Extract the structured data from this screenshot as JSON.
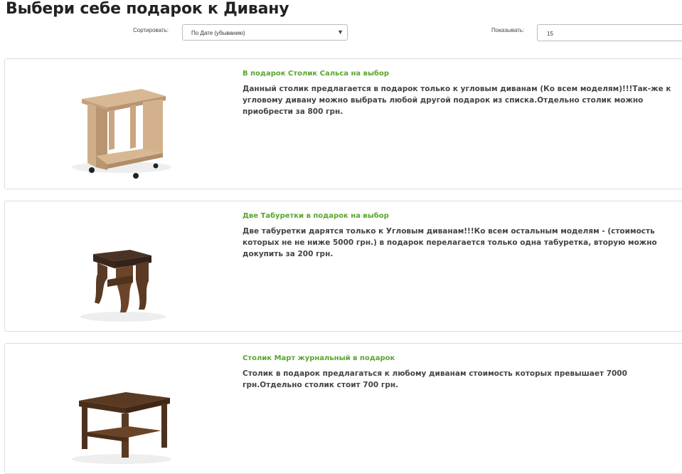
{
  "page": {
    "title": "Выбери себе подарок к Дивану"
  },
  "toolbar": {
    "sort_label": "Сортировать:",
    "sort_value": "По Дате (убыванию)",
    "show_label": "Показывать:",
    "show_value": "15"
  },
  "products": [
    {
      "title": "В подарок Столик Сальса на выбор",
      "description": "Данный столик предлагается в подарок только к угловым диванам (Ко всем моделям)!!!Так-же к угловому дивану можно выбрать любой другой подарок из списка.Отдельно столик можно приобрести за 800 грн.",
      "image": "light-oak-side-table"
    },
    {
      "title": "Две Табуретки в подарок на выбор",
      "description": "Две табуретки дарятся только к Угловым диванам!!!Ко всем остальным моделям - (стоимость которых не не ниже 5000 грн.) в подарок перелагается только одна табуретка, вторую можно докупить за 200 грн.",
      "image": "dark-wood-stool"
    },
    {
      "title": "Столик Март журнальный в подарок",
      "description": "Столик в подарок предлагаться к любому диванам стоимость которых превышает 7000 грн.Отдельно столик стоит 700 грн.",
      "image": "dark-wood-coffee-table"
    }
  ],
  "colors": {
    "title_green": "#5aa530",
    "text": "#444444",
    "border": "#dddddd"
  }
}
